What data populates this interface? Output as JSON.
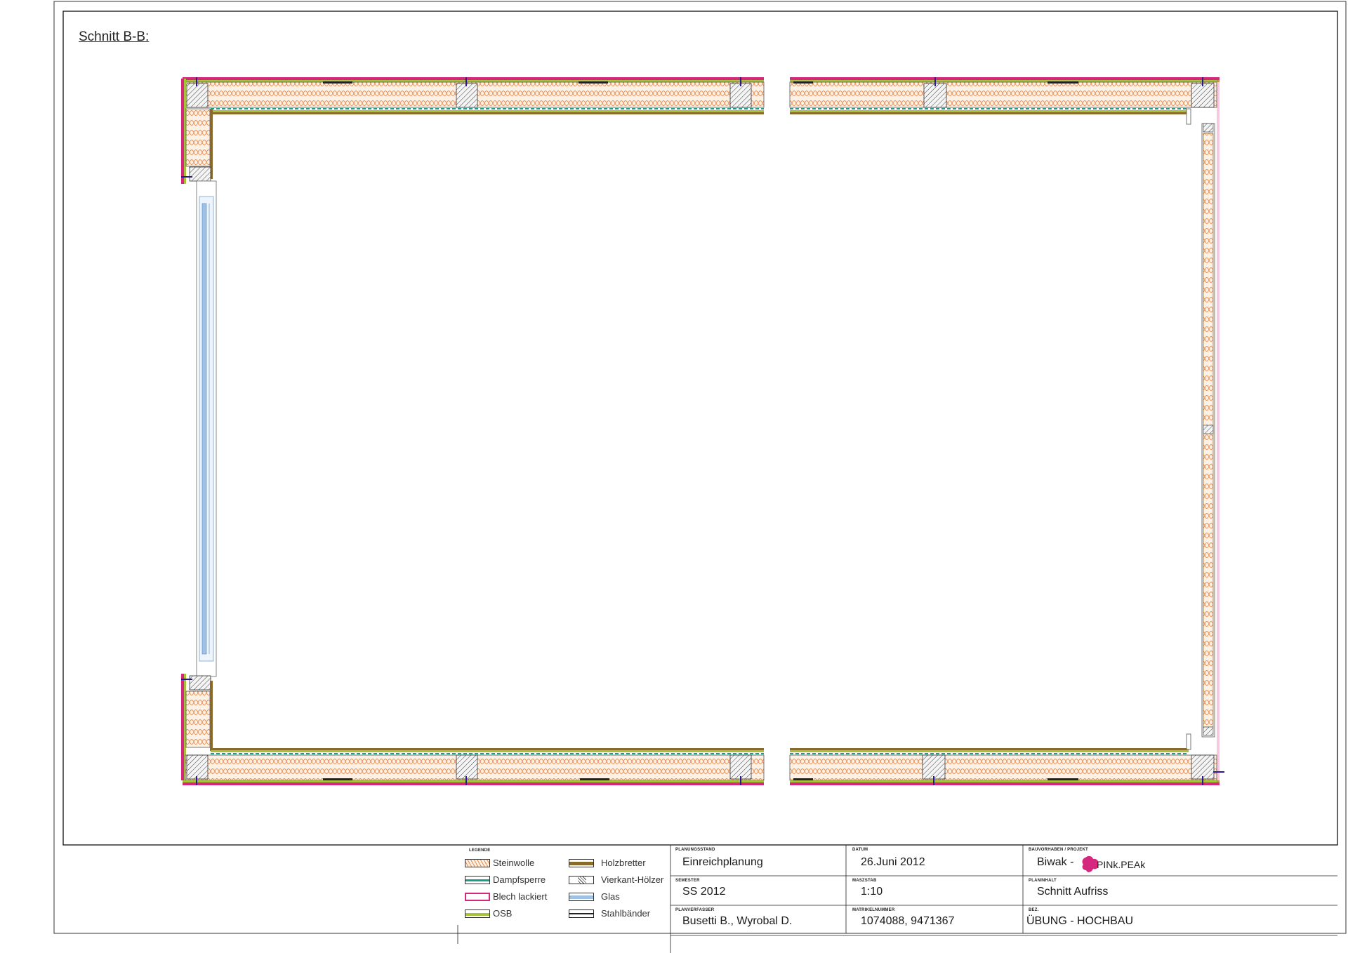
{
  "drawing": {
    "section_title": "Schnitt B-B:"
  },
  "legend": {
    "heading": "LEGENDE",
    "items": [
      {
        "label": "Steinwolle",
        "symbol": "insulation-icon",
        "color": "#e8894a"
      },
      {
        "label": "Dampfsperre",
        "symbol": "vapor-barrier-icon",
        "color": "#1a9e8a"
      },
      {
        "label": "Blech lackiert",
        "symbol": "painted-sheet-icon",
        "color": "#d6277f"
      },
      {
        "label": "OSB",
        "symbol": "osb-icon",
        "color": "#a6c13a"
      },
      {
        "label": "Holzbretter",
        "symbol": "wood-boards-icon",
        "color": "#8a6a2a"
      },
      {
        "label": "Vierkant-Hölzer",
        "symbol": "square-timber-icon",
        "color": "#555555"
      },
      {
        "label": "Glas",
        "symbol": "glass-icon",
        "color": "#9ec2e6"
      },
      {
        "label": "Stahlbänder",
        "symbol": "steel-band-icon",
        "color": "#222222"
      }
    ]
  },
  "title_block": {
    "planungsstand": {
      "label": "PLANUNGSSTAND",
      "value": "Einreichplanung"
    },
    "datum": {
      "label": "DATUM",
      "value": "26.Juni 2012"
    },
    "projekt": {
      "label": "BAUVORHABEN / PROJEKT",
      "value": "Biwak -",
      "logo_text": "PINk.PEAk"
    },
    "semester": {
      "label": "SEMESTER",
      "value": "SS 2012"
    },
    "massstab": {
      "label": "MASZSTAB",
      "value": "1:10"
    },
    "planinhalt": {
      "label": "PLANINHALT",
      "value": "Schnitt Aufriss"
    },
    "planverfasser": {
      "label": "PLANVERFASSER",
      "value": "Busetti B., Wyrobal D."
    },
    "matrikelnummer": {
      "label": "MATRIKELNUMMER",
      "value": "1074088, 9471367"
    },
    "bez": {
      "label": "BEZ.",
      "value": "ÜBUNG - HOCHBAU"
    }
  },
  "colors": {
    "insulation": "#e8894a",
    "vapor_barrier": "#1a9e8a",
    "sheet_metal": "#d6277f",
    "osb": "#a6c13a",
    "wood": "#8a6a2a",
    "glass": "#9ec2e6",
    "steel": "#222222",
    "bolt": "#2a1a8a"
  }
}
